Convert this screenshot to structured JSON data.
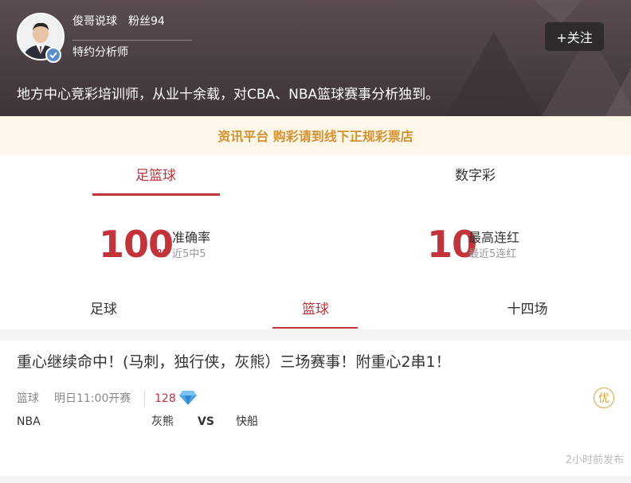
{
  "header": {
    "author_name": "俊哥说球",
    "fans": "粉丝94",
    "role": "特约分析师",
    "follow_label": "+关注",
    "bio": "地方中心竞彩培训师，从业十余载，对CBA、NBA篮球赛事分析独到。",
    "verified_icon": "verified-badge-icon"
  },
  "notice": "资讯平台 购彩请到线下正规彩票店",
  "main_tabs": [
    {
      "label": "足篮球",
      "active": true
    },
    {
      "label": "数字彩",
      "active": false
    }
  ],
  "stats": {
    "accuracy": {
      "value": "100",
      "unit": "%",
      "label": "准确率",
      "sub": "近5中5"
    },
    "streak": {
      "value": "10",
      "label": "最高连红",
      "sub": "最近5连红"
    }
  },
  "sub_tabs": [
    {
      "label": "足球",
      "active": false
    },
    {
      "label": "篮球",
      "active": true
    },
    {
      "label": "十四场",
      "active": false
    }
  ],
  "article": {
    "title": "重心继续命中！(马刺，独行侠，灰熊）三场赛事！附重心2串1！",
    "sport": "篮球",
    "time": "明日11:00开赛",
    "price": "128",
    "price_icon": "diamond-icon",
    "badge": "优",
    "league": "NBA",
    "home": "灰熊",
    "vs": "VS",
    "away": "快船",
    "published": "2小时前发布"
  },
  "colors": {
    "accent": "#c4323a",
    "notice_text": "#d6912e",
    "notice_bg": "#fdf7ea",
    "header_bg": "#4a3f44",
    "diamond": "#4aa3e8",
    "badge": "#e0a53a"
  }
}
